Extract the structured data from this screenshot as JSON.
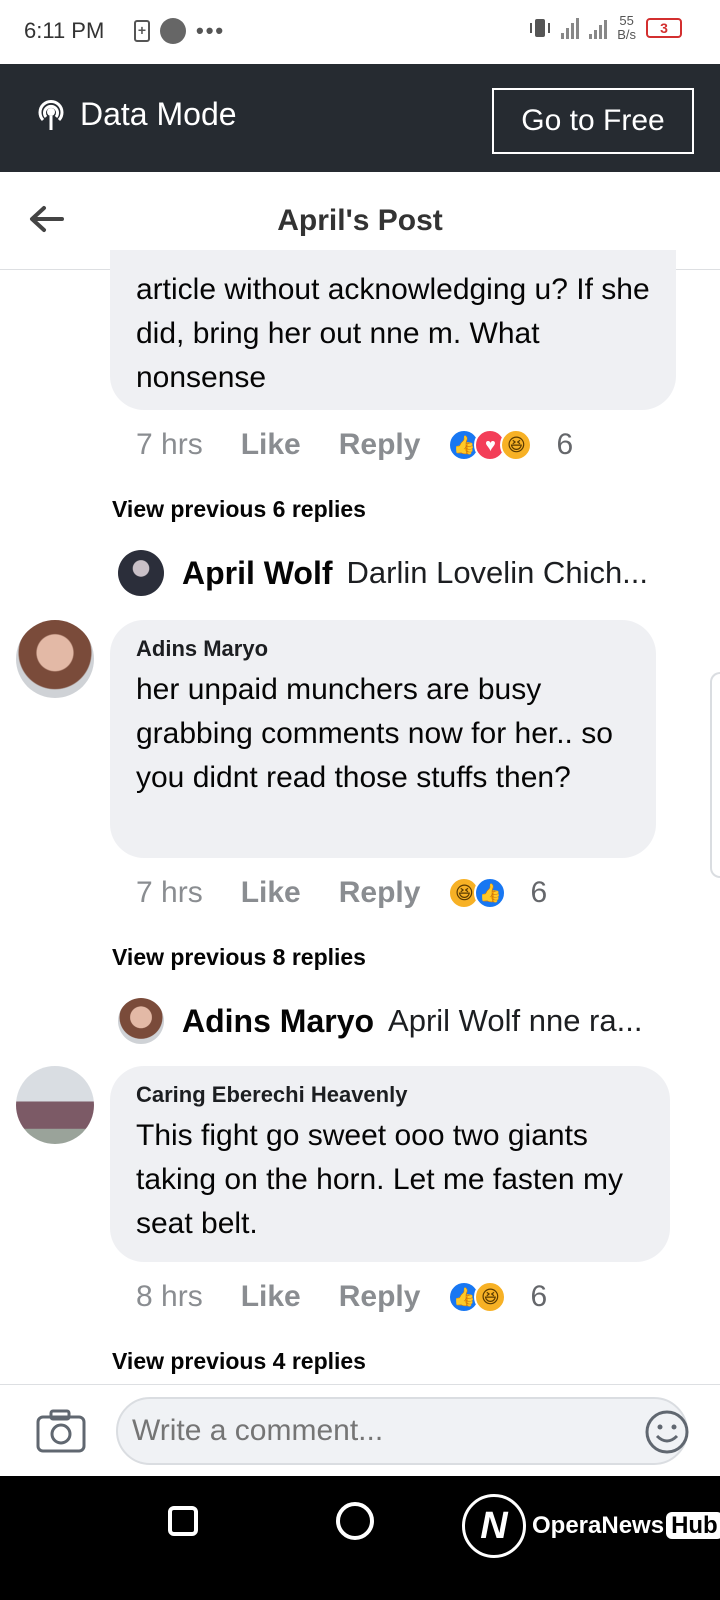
{
  "status_bar": {
    "time": "6:11 PM",
    "left_icons": [
      "battery-saver-icon",
      "app-notification-icon",
      "more-dots-icon"
    ],
    "dots": "•••",
    "net_speed_value": "55",
    "net_speed_unit": "B/s",
    "battery_level": "3"
  },
  "data_mode": {
    "label": "Data Mode",
    "button": "Go to Free"
  },
  "header": {
    "title": "April's Post"
  },
  "comments": [
    {
      "author": "",
      "text": "article without acknowledging u? If she did, bring her out nne m. What nonsense",
      "time": "7 hrs",
      "like": "Like",
      "reply": "Reply",
      "reactions": [
        "like",
        "love",
        "haha"
      ],
      "reaction_count": "6",
      "view_previous": "View previous 6 replies",
      "latest_reply": {
        "name": "April Wolf",
        "text": "Darlin Lovelin Chich..."
      }
    },
    {
      "author": "Adins Maryo",
      "text": "her unpaid munchers are busy grabbing comments now for her.. so you didnt read those stuffs then?",
      "time": "7 hrs",
      "like": "Like",
      "reply": "Reply",
      "reactions": [
        "haha",
        "like"
      ],
      "reaction_count": "6",
      "view_previous": "View previous 8 replies",
      "latest_reply": {
        "name": "Adins Maryo",
        "text": "April Wolf nne ra..."
      }
    },
    {
      "author": "Caring Eberechi Heavenly",
      "text": "This fight go sweet ooo two giants taking on the horn. Let me fasten my seat belt.",
      "time": "8 hrs",
      "like": "Like",
      "reply": "Reply",
      "reactions": [
        "like",
        "haha"
      ],
      "reaction_count": "6",
      "view_previous": "View previous 4 replies"
    }
  ],
  "composer": {
    "placeholder": "Write a comment..."
  },
  "navbar": {
    "watermark_text": "OperaNews",
    "watermark_hub": "Hub"
  },
  "colors": {
    "data_mode_bg": "#262b31",
    "bubble_bg": "#eff0f3",
    "like_blue": "#1877f2",
    "love_red": "#f33e58",
    "haha_yellow": "#f7b125"
  }
}
